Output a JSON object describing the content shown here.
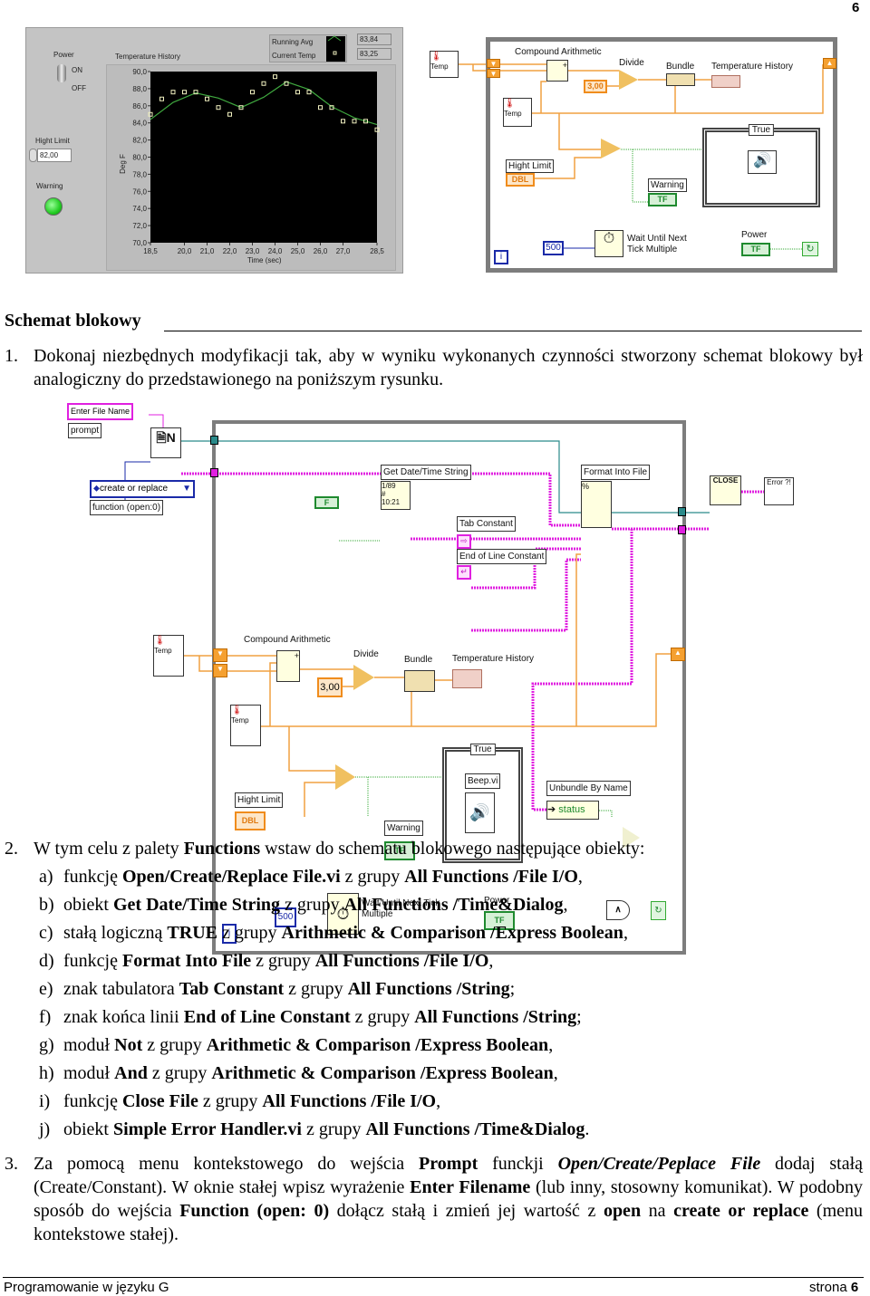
{
  "page_number": "6",
  "front_panel": {
    "power": {
      "label": "Power",
      "on": "ON",
      "off": "OFF",
      "state": "ON"
    },
    "high_limit": {
      "label": "Hight Limit",
      "value": "82,00"
    },
    "warning": {
      "label": "Warning",
      "lit": true,
      "color": "#3ee03e"
    },
    "graph": {
      "title": "Temperature History",
      "ylabel": "Deg F",
      "xlabel": "Time (sec)",
      "ylim": [
        70,
        90
      ],
      "xlim": [
        18.5,
        28.5
      ],
      "y_ticks": [
        "70,0",
        "72,0",
        "74,0",
        "76,0",
        "78,0",
        "80,0",
        "82,0",
        "84,0",
        "86,0",
        "88,0",
        "90,0"
      ],
      "x_ticks": [
        "18,5",
        "20,0",
        "21,0",
        "22,0",
        "23,0",
        "24,0",
        "25,0",
        "26,0",
        "27,0",
        "28,5"
      ],
      "x_tick_values": [
        18.5,
        20,
        21,
        22,
        23,
        24,
        25,
        26,
        27,
        28.5
      ],
      "legend": [
        {
          "name": "Running Avg",
          "value": "83,84",
          "color": "#3fa83f"
        },
        {
          "name": "Current Temp",
          "value": "83,25",
          "color": "#f0f0c0"
        }
      ],
      "current_temp": {
        "x": [
          18.5,
          19,
          19.5,
          20,
          20.5,
          21,
          21.5,
          22,
          22.5,
          23,
          23.5,
          24,
          24.5,
          25,
          25.5,
          26,
          26.5,
          27,
          27.5,
          28,
          28.5
        ],
        "y": [
          85.0,
          86.8,
          87.6,
          87.6,
          87.6,
          86.8,
          85.8,
          85.0,
          85.8,
          87.6,
          88.6,
          89.4,
          88.6,
          87.6,
          87.6,
          85.8,
          85.8,
          84.2,
          84.2,
          84.2,
          83.2
        ]
      },
      "running_avg": {
        "x": [
          18.5,
          19.5,
          20.5,
          21.5,
          22.5,
          23.5,
          24.5,
          25.5,
          26.5,
          27.5,
          28.5
        ],
        "y": [
          84.4,
          86.4,
          87.5,
          86.9,
          85.8,
          87.0,
          88.8,
          87.9,
          85.9,
          84.6,
          83.8
        ]
      }
    }
  },
  "diagram1": {
    "temp": "Temp",
    "compound": "Compound Arithmetic",
    "divide": "Divide",
    "const": "3,00",
    "bundle": "Bundle",
    "history": "Temperature History",
    "high_limit": "Hight Limit",
    "dbl": "DBL",
    "case_sel": "True",
    "warning": "Warning",
    "tf": "TF",
    "wait_value": "500",
    "wait": "Wait Until Next Tick Multiple",
    "power": "Power",
    "iter": "i"
  },
  "section_title": "Schemat blokowy",
  "para1": {
    "num": "1.",
    "segs": [
      {
        "t": "Dokonaj niezbędnych modyfikacji tak, aby w wyniku wykonanych czynności stworzony schemat blokowy był analogiczny do przedstawionego na poniższym rysunku."
      }
    ]
  },
  "diagram2": {
    "enter_file": "Enter File Name",
    "prompt": "prompt",
    "create": "create or replace",
    "function": "function (open:0)",
    "get_date": "Get Date/Time String",
    "tf_false": "F",
    "format": "Format Into File",
    "tab": "Tab Constant",
    "eol": "End of Line Constant",
    "temp": "Temp",
    "compound": "Compound Arithmetic",
    "divide": "Divide",
    "const": "3,00",
    "bundle": "Bundle",
    "history": "Temperature History",
    "high_limit": "Hight Limit",
    "dbl": "DBL",
    "case_sel": "True",
    "beep": "Beep.vi",
    "warning": "Warning",
    "tf": "TF",
    "unbundle": "Unbundle By Name",
    "status": "status",
    "wait_value": "500",
    "wait": "Wait Until Next Tick Multiple",
    "power": "Power",
    "iter": "i",
    "close": "CLOSE",
    "error": "Error ?!"
  },
  "para2": {
    "num": "2.",
    "segs": [
      {
        "t": "W tym celu z palety "
      },
      {
        "t": "Functions",
        "b": true
      },
      {
        "t": " wstaw do schematu blokowego następujące obiekty:"
      }
    ]
  },
  "list": [
    {
      "letter": "a)",
      "segs": [
        {
          "t": "funkcję "
        },
        {
          "t": "Open/Create/Replace File.vi",
          "b": true
        },
        {
          "t": " z grupy "
        },
        {
          "t": "All Functions /File I/O",
          "b": true
        },
        {
          "t": ","
        }
      ]
    },
    {
      "letter": "b)",
      "segs": [
        {
          "t": "obiekt "
        },
        {
          "t": "Get Date/Time String",
          "b": true
        },
        {
          "t": " z grupy "
        },
        {
          "t": "All Functions /Time&Dialog",
          "b": true
        },
        {
          "t": ","
        }
      ]
    },
    {
      "letter": "c)",
      "segs": [
        {
          "t": "stałą logiczną "
        },
        {
          "t": "TRUE",
          "b": true
        },
        {
          "t": " z grupy "
        },
        {
          "t": "Arithmetic & Comparison /Express Boolean",
          "b": true
        },
        {
          "t": ","
        }
      ]
    },
    {
      "letter": "d)",
      "segs": [
        {
          "t": "funkcję "
        },
        {
          "t": "Format Into File",
          "b": true
        },
        {
          "t": " z grupy "
        },
        {
          "t": "All Functions /File I/O",
          "b": true
        },
        {
          "t": ","
        }
      ]
    },
    {
      "letter": "e)",
      "segs": [
        {
          "t": "znak tabulatora "
        },
        {
          "t": "Tab Constant",
          "b": true
        },
        {
          "t": " z grupy "
        },
        {
          "t": "All Functions /String",
          "b": true
        },
        {
          "t": ";"
        }
      ]
    },
    {
      "letter": "f)",
      "segs": [
        {
          "t": "znak końca linii "
        },
        {
          "t": "End of Line Constant",
          "b": true
        },
        {
          "t": " z grupy "
        },
        {
          "t": "All Functions /String",
          "b": true
        },
        {
          "t": ";"
        }
      ]
    },
    {
      "letter": "g)",
      "segs": [
        {
          "t": "moduł "
        },
        {
          "t": "Not",
          "b": true
        },
        {
          "t": " z grupy "
        },
        {
          "t": "Arithmetic & Comparison /Express Boolean",
          "b": true
        },
        {
          "t": ","
        }
      ]
    },
    {
      "letter": "h)",
      "segs": [
        {
          "t": "moduł "
        },
        {
          "t": "And",
          "b": true
        },
        {
          "t": " z grupy "
        },
        {
          "t": "Arithmetic & Comparison /Express Boolean",
          "b": true
        },
        {
          "t": ","
        }
      ]
    },
    {
      "letter": "i)",
      "segs": [
        {
          "t": "funkcję "
        },
        {
          "t": "Close File",
          "b": true
        },
        {
          "t": " z grupy "
        },
        {
          "t": "All Functions /File I/O",
          "b": true
        },
        {
          "t": ","
        }
      ]
    },
    {
      "letter": "j)",
      "segs": [
        {
          "t": "obiekt "
        },
        {
          "t": "Simple Error Handler.vi",
          "b": true
        },
        {
          "t": " z grupy "
        },
        {
          "t": "All Functions /Time&Dialog",
          "b": true
        },
        {
          "t": "."
        }
      ]
    }
  ],
  "para3": {
    "num": "3.",
    "segs": [
      {
        "t": "Za pomocą menu kontekstowego do wejścia "
      },
      {
        "t": "Prompt",
        "b": true
      },
      {
        "t": " funckji "
      },
      {
        "t": "Open/Create/Peplace File",
        "b": true,
        "i": true
      },
      {
        "t": " dodaj stałą (Create/Constant). W oknie stałej wpisz wyrażenie "
      },
      {
        "t": "Enter Filename",
        "b": true
      },
      {
        "t": " (lub inny, stosowny komunikat). W podobny sposób do wejścia "
      },
      {
        "t": "Function (open: 0)",
        "b": true
      },
      {
        "t": " dołącz stałą i zmień jej wartość z "
      },
      {
        "t": "open",
        "b": true
      },
      {
        "t": " na "
      },
      {
        "t": "create or replace",
        "b": true
      },
      {
        "t": " (menu kontekstowe stałej)."
      }
    ]
  },
  "footer": {
    "left": "Programowanie w języku G",
    "right_prefix": "strona ",
    "right_num": "6"
  }
}
